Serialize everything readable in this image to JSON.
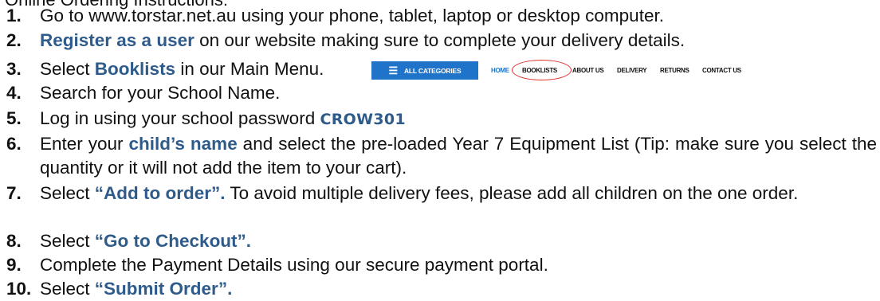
{
  "heading": "Online Ordering Instructions:",
  "steps": [
    {
      "num": "1.",
      "text": "Go to www.torstar.net.au using your phone, tablet, laptop or desktop computer."
    },
    {
      "num": "2.",
      "highlight": "Register as a user",
      "text": " on our website making sure to complete your delivery details."
    },
    {
      "num": "3.",
      "pre": "Select ",
      "highlight": "Booklists",
      "post": " in our Main Menu."
    },
    {
      "num": "4.",
      "text": "Search for your School Name."
    },
    {
      "num": "5.",
      "pre": "Log in using your school password ",
      "highlight": "CROW301"
    },
    {
      "num": "6.",
      "pre": "Enter your ",
      "highlight": "child’s name",
      "post": " and select the pre-loaded Year 7 Equipment List (Tip: make sure you select the quantity or it will not add the item to your cart)."
    },
    {
      "num": "7.",
      "pre": "Select ",
      "highlight": "“Add to order”.",
      "post": " To avoid multiple delivery fees, please add all children on the one order."
    },
    {
      "num": "8.",
      "pre": "Select ",
      "highlight": "“Go to Checkout”."
    },
    {
      "num": "9.",
      "text": "Complete the Payment Details using our secure payment portal."
    },
    {
      "num": "10.",
      "pre": "Select ",
      "highlight": "“Submit Order”."
    }
  ],
  "menu": {
    "categories_label": "ALL CATEGORIES",
    "categories_icon": "menu-bars-icon",
    "links": [
      "HOME",
      "BOOKLISTS",
      "ABOUT US",
      "DELIVERY",
      "RETURNS",
      "CONTACT US"
    ],
    "button_color": "#1f74c9",
    "circle_color": "#e0302c"
  },
  "colors": {
    "highlight": "#2f5b8a",
    "text": "#111111"
  }
}
